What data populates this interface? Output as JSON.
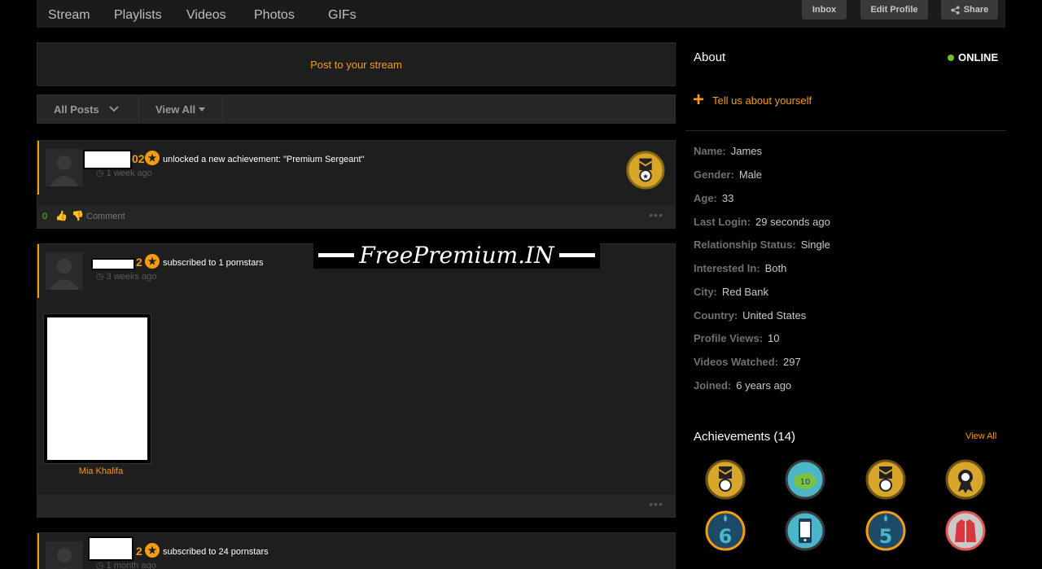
{
  "nav": {
    "tabs": [
      "Stream",
      "Playlists",
      "Videos",
      "Photos",
      "GIFs"
    ],
    "inbox": "Inbox",
    "edit_profile": "Edit Profile",
    "share": "Share"
  },
  "stream": {
    "post_prompt": "Post to your stream",
    "filter_all_posts": "All Posts",
    "filter_view_all": "View All"
  },
  "posts": [
    {
      "rank_suffix": "02",
      "action": "unlocked a new achievement: \"Premium Sergeant\"",
      "time": "1 week ago",
      "likes": "0",
      "comment_label": "Comment"
    },
    {
      "rank_suffix": "2",
      "action": "subscribed to 1 pornstars",
      "time": "3 weeks ago",
      "pornstar_name": "Mia Khalifa"
    },
    {
      "rank_suffix": "2",
      "action": "subscribed to 24 pornstars",
      "time": "1 month ago"
    }
  ],
  "watermark": "FreePremium.IN",
  "about": {
    "title": "About",
    "status": "ONLINE",
    "tell_us": "Tell us about yourself",
    "fields": [
      {
        "label": "Name:",
        "value": "James"
      },
      {
        "label": "Gender:",
        "value": "Male"
      },
      {
        "label": "Age:",
        "value": "33"
      },
      {
        "label": "Last Login:",
        "value": "29 seconds ago"
      },
      {
        "label": "Relationship Status:",
        "value": "Single"
      },
      {
        "label": "Interested In:",
        "value": "Both"
      },
      {
        "label": "City:",
        "value": "Red Bank"
      },
      {
        "label": "Country:",
        "value": "United States"
      },
      {
        "label": "Profile Views:",
        "value": "10"
      },
      {
        "label": "Videos Watched:",
        "value": "297"
      },
      {
        "label": "Joined:",
        "value": "6 years ago"
      }
    ]
  },
  "achievements": {
    "title": "Achievements (14)",
    "view_all": "View All",
    "badges": [
      {
        "icon": "sergeant-medal-icon"
      },
      {
        "icon": "piggy-bank-10-icon",
        "label": "10"
      },
      {
        "icon": "sergeant-medal-icon"
      },
      {
        "icon": "rosette-icon"
      },
      {
        "icon": "candle-6-icon",
        "label": "6"
      },
      {
        "icon": "mobile-phone-icon"
      },
      {
        "icon": "candle-5-icon",
        "label": "5"
      },
      {
        "icon": "jacket-icon"
      }
    ]
  },
  "colors": {
    "accent": "#f39c12",
    "online": "#6fbf2f",
    "background": "#000000",
    "panel": "#1e1e1e"
  }
}
